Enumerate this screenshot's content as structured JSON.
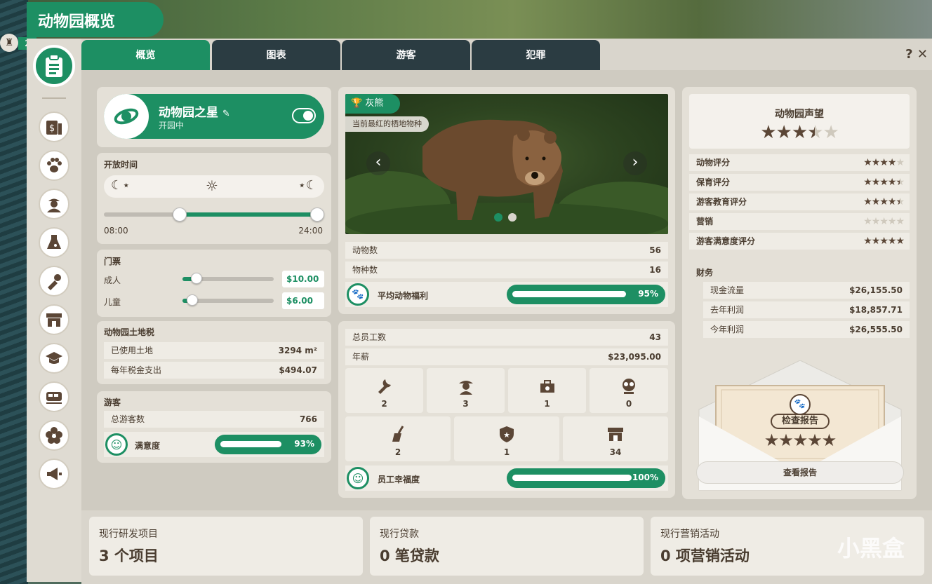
{
  "header": {
    "title": "动物园概览",
    "player_count": "2"
  },
  "tabs": [
    {
      "label": "概览",
      "active": true
    },
    {
      "label": "图表",
      "active": false
    },
    {
      "label": "游客",
      "active": false
    },
    {
      "label": "犯罪",
      "active": false
    }
  ],
  "window_controls": {
    "help": "?",
    "close": "✕"
  },
  "zoo_star": {
    "title": "动物园之星",
    "status": "开园中",
    "toggle_on": true
  },
  "opening_hours": {
    "label": "开放时间",
    "open": "08:00",
    "close": "24:00"
  },
  "tickets": {
    "label": "门票",
    "adult": {
      "label": "成人",
      "price": "$10.00"
    },
    "child": {
      "label": "儿童",
      "price": "$6.00"
    }
  },
  "land_tax": {
    "label": "动物园土地税",
    "used_land": {
      "label": "已使用土地",
      "value": "3294 m²"
    },
    "annual_tax": {
      "label": "每年税金支出",
      "value": "$494.07"
    }
  },
  "guests": {
    "label": "游客",
    "total": {
      "label": "总游客数",
      "value": "766"
    },
    "satisfaction": {
      "label": "满意度",
      "value": "93%",
      "fraction": 0.93
    }
  },
  "featured": {
    "badge": "灰熊",
    "subtitle": "当前最红的栖地物种",
    "carousel_pages": 2,
    "carousel_active": 0
  },
  "animals": {
    "count": {
      "label": "动物数",
      "value": "56"
    },
    "species": {
      "label": "物种数",
      "value": "16"
    },
    "welfare": {
      "label": "平均动物福利",
      "value": "95%",
      "fraction": 0.95
    }
  },
  "staff": {
    "total": {
      "label": "总员工数",
      "value": "43"
    },
    "salary": {
      "label": "年薪",
      "value": "$23,095.00"
    },
    "roles_row1": [
      {
        "icon": "wrench-icon",
        "count": "2"
      },
      {
        "icon": "keeper-icon",
        "count": "3"
      },
      {
        "icon": "vet-icon",
        "count": "1"
      },
      {
        "icon": "educator-icon",
        "count": "0"
      }
    ],
    "roles_row2": [
      {
        "icon": "broom-icon",
        "count": "2"
      },
      {
        "icon": "security-icon",
        "count": "1"
      },
      {
        "icon": "vendor-icon",
        "count": "34"
      }
    ],
    "happiness": {
      "label": "员工幸福度",
      "value": "100%",
      "fraction": 1.0
    }
  },
  "reputation": {
    "title": "动物园声望",
    "stars": 3.5,
    "ratings": [
      {
        "label": "动物评分",
        "stars": 4
      },
      {
        "label": "保育评分",
        "stars": 4.5
      },
      {
        "label": "游客教育评分",
        "stars": 4.5
      },
      {
        "label": "营销",
        "stars": 0
      },
      {
        "label": "游客满意度评分",
        "stars": 5
      }
    ]
  },
  "finance": {
    "label": "财务",
    "items": [
      {
        "label": "现金流量",
        "value": "$26,155.50"
      },
      {
        "label": "去年利润",
        "value": "$18,857.71"
      },
      {
        "label": "今年利润",
        "value": "$26,555.50"
      }
    ]
  },
  "report": {
    "badge": "检查报告",
    "stars": 5,
    "button": "查看报告"
  },
  "bottom": [
    {
      "title": "现行研发项目",
      "value": "3 个项目"
    },
    {
      "title": "现行贷款",
      "value": "0 笔贷款"
    },
    {
      "title": "现行营销活动",
      "value": "0 项营销活动"
    }
  ],
  "watermark": "小黑盒",
  "colors": {
    "accent": "#1d8f63",
    "text": "#4a3d30",
    "panel": "#e4e0d7"
  }
}
